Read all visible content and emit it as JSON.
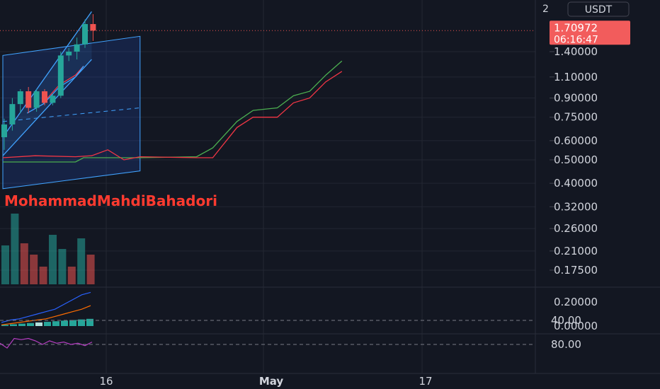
{
  "chart_data": {
    "type": "candlestick",
    "price_axis": {
      "currency": "USDT",
      "top_tick": "2",
      "scale": "log",
      "ticks": [
        1.4,
        1.1,
        0.9,
        0.75,
        0.6,
        0.5,
        0.4,
        0.32,
        0.26,
        0.21,
        0.175
      ],
      "tick_labels": [
        "1.40000",
        "1.10000",
        "0.90000",
        "0.75000",
        "0.60000",
        "0.50000",
        "0.40000",
        "0.32000",
        "0.26000",
        "0.21000",
        "0.17500"
      ],
      "current_price": "1.70972",
      "countdown": "06:16:47",
      "current_price_value": 1.70972
    },
    "time_axis": {
      "labels": [
        "16",
        "May",
        "17"
      ]
    },
    "watermark": "MohammadMahdiBahadori",
    "candles": [
      {
        "o": 0.62,
        "h": 0.74,
        "l": 0.55,
        "c": 0.7,
        "dir": "up"
      },
      {
        "o": 0.7,
        "h": 0.9,
        "l": 0.66,
        "c": 0.85,
        "dir": "up"
      },
      {
        "o": 0.85,
        "h": 0.98,
        "l": 0.78,
        "c": 0.96,
        "dir": "up"
      },
      {
        "o": 0.96,
        "h": 1.0,
        "l": 0.78,
        "c": 0.82,
        "dir": "down"
      },
      {
        "o": 0.82,
        "h": 0.98,
        "l": 0.79,
        "c": 0.96,
        "dir": "up"
      },
      {
        "o": 0.96,
        "h": 0.98,
        "l": 0.84,
        "c": 0.86,
        "dir": "down"
      },
      {
        "o": 0.86,
        "h": 0.94,
        "l": 0.84,
        "c": 0.92,
        "dir": "up"
      },
      {
        "o": 0.92,
        "h": 1.4,
        "l": 0.9,
        "c": 1.35,
        "dir": "up"
      },
      {
        "o": 1.35,
        "h": 1.45,
        "l": 1.28,
        "c": 1.4,
        "dir": "up"
      },
      {
        "o": 1.4,
        "h": 1.6,
        "l": 1.3,
        "c": 1.5,
        "dir": "up"
      },
      {
        "o": 1.5,
        "h": 1.9,
        "l": 1.45,
        "c": 1.82,
        "dir": "up"
      },
      {
        "o": 1.82,
        "h": 2.0,
        "l": 1.55,
        "c": 1.70972,
        "dir": "down"
      }
    ],
    "channel_lines": [
      {
        "name": "",
        "color": "#41a3ff",
        "points": [
          [
            0,
            0.62
          ],
          [
            11,
            2.05
          ]
        ]
      },
      {
        "name": "",
        "color": "#41a3ff",
        "points": [
          [
            0,
            0.52
          ],
          [
            11,
            1.3
          ]
        ]
      }
    ],
    "price_box": {
      "top_left": [
        0,
        1.35
      ],
      "top_right": [
        17,
        1.62
      ],
      "bottom_left": [
        0,
        0.38
      ],
      "bottom_right": [
        17,
        0.45
      ],
      "mid_left": [
        0,
        0.72
      ],
      "mid_right": [
        17,
        0.82
      ]
    },
    "indicator_lines": [
      {
        "color": "#4caf50",
        "points": [
          [
            0,
            0.49
          ],
          [
            4,
            0.49
          ],
          [
            9,
            0.49
          ],
          [
            10,
            0.51
          ],
          [
            11,
            0.51
          ],
          [
            14,
            0.51
          ],
          [
            17,
            0.51
          ],
          [
            24,
            0.515
          ],
          [
            26,
            0.56
          ],
          [
            29,
            0.72
          ],
          [
            31,
            0.8
          ],
          [
            34,
            0.82
          ],
          [
            36,
            0.92
          ],
          [
            38,
            0.96
          ],
          [
            40,
            1.12
          ],
          [
            42,
            1.28
          ]
        ]
      },
      {
        "color": "#f23645",
        "points": [
          [
            0,
            0.51
          ],
          [
            4,
            0.52
          ],
          [
            9,
            0.515
          ],
          [
            11,
            0.52
          ],
          [
            13,
            0.55
          ],
          [
            15,
            0.5
          ],
          [
            17,
            0.515
          ],
          [
            24,
            0.51
          ],
          [
            26,
            0.51
          ],
          [
            29,
            0.68
          ],
          [
            31,
            0.75
          ],
          [
            34,
            0.75
          ],
          [
            36,
            0.86
          ],
          [
            38,
            0.9
          ],
          [
            40,
            1.05
          ],
          [
            42,
            1.16
          ]
        ]
      },
      {
        "color": "#f23645",
        "points": [
          [
            5,
            0.86
          ],
          [
            7,
            1.02
          ],
          [
            9,
            1.12
          ],
          [
            10,
            1.22
          ]
        ]
      },
      {
        "color": "#41a3ff",
        "points": [
          [
            3,
            0.78
          ],
          [
            5,
            0.85
          ],
          [
            7,
            1.0
          ],
          [
            9,
            1.1
          ],
          [
            10,
            1.22
          ]
        ]
      }
    ],
    "volume": [
      {
        "v": 55,
        "dir": "up"
      },
      {
        "v": 100,
        "dir": "up"
      },
      {
        "v": 58,
        "dir": "down"
      },
      {
        "v": 42,
        "dir": "down"
      },
      {
        "v": 25,
        "dir": "down"
      },
      {
        "v": 70,
        "dir": "up"
      },
      {
        "v": 50,
        "dir": "up"
      },
      {
        "v": 25,
        "dir": "down"
      },
      {
        "v": 65,
        "dir": "up"
      },
      {
        "v": 42,
        "dir": "down"
      }
    ],
    "macd_pane": {
      "ticks": [
        0.2,
        0.0
      ],
      "tick_labels": [
        "0.20000",
        "0.00000"
      ],
      "histogram": [
        0.01,
        0.015,
        0.02,
        0.025,
        0.03,
        0.035,
        0.04,
        0.045,
        0.05,
        0.055,
        0.06
      ],
      "macd_line": [
        0.03,
        0.05,
        0.06,
        0.08,
        0.1,
        0.12,
        0.14,
        0.18,
        0.22,
        0.26,
        0.28
      ],
      "signal_line": [
        0.01,
        0.02,
        0.03,
        0.04,
        0.05,
        0.06,
        0.08,
        0.1,
        0.12,
        0.14,
        0.17
      ]
    },
    "rsi_pane": {
      "ticks": [
        80,
        40
      ],
      "tick_labels": [
        "80.00",
        "40.00"
      ],
      "band": [
        40,
        80
      ],
      "values": [
        78,
        86,
        70,
        72,
        70,
        74,
        80,
        74,
        78,
        76,
        80,
        78,
        82,
        76
      ]
    },
    "colors": {
      "background": "#131722",
      "up": "#26a69a",
      "down": "#ef5350",
      "grid": "#232733",
      "axis_text": "#d1d4dc",
      "price_label_bg": "#f25c5c",
      "channel": "#41a3ff",
      "watermark": "#ff3b30",
      "rsi_line": "#b83ec4",
      "rsi_band": "#2c1f3c",
      "macd_line": "#2962ff",
      "signal_line": "#ff6d00"
    }
  }
}
